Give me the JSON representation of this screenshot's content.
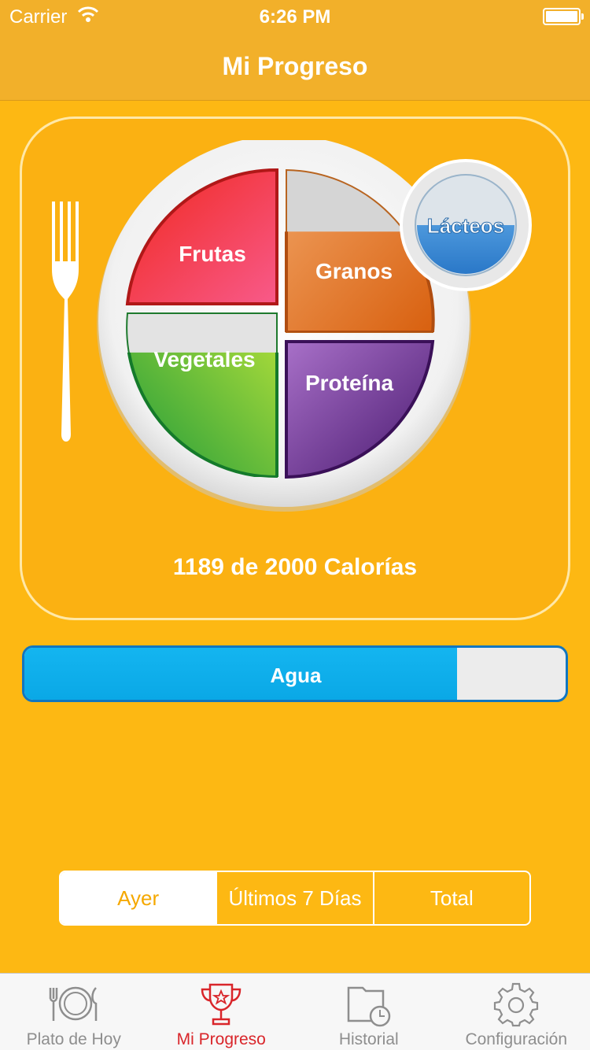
{
  "status_bar": {
    "carrier": "Carrier",
    "time": "6:26 PM"
  },
  "nav": {
    "title": "Mi Progreso"
  },
  "plate": {
    "groups": {
      "frutas": {
        "label": "Frutas",
        "progress": 1.0,
        "color": "#E8242C"
      },
      "granos": {
        "label": "Granos",
        "progress": 0.62,
        "color": "#E36F1E"
      },
      "vegetales": {
        "label": "Vegetales",
        "progress": 0.76,
        "color": "#3DB14A"
      },
      "proteina": {
        "label": "Proteína",
        "progress": 1.0,
        "color": "#6B2C91"
      },
      "lacteos": {
        "label": "Lácteos",
        "progress": 0.5,
        "color": "#3A8FD8"
      }
    },
    "calories_text": "1189 de 2000 Calorías"
  },
  "water": {
    "label": "Agua",
    "progress": 0.8,
    "color": "#0AA8E6"
  },
  "segments": {
    "ayer": "Ayer",
    "ultimos": "Últimos 7 Días",
    "total": "Total",
    "selected": "Ayer"
  },
  "tabs": {
    "plato": {
      "label": "Plato de Hoy",
      "icon": "plate-icon"
    },
    "progreso": {
      "label": "Mi Progreso",
      "icon": "trophy-icon"
    },
    "historial": {
      "label": "Historial",
      "icon": "folder-clock-icon"
    },
    "config": {
      "label": "Configuración",
      "icon": "gear-icon"
    }
  }
}
